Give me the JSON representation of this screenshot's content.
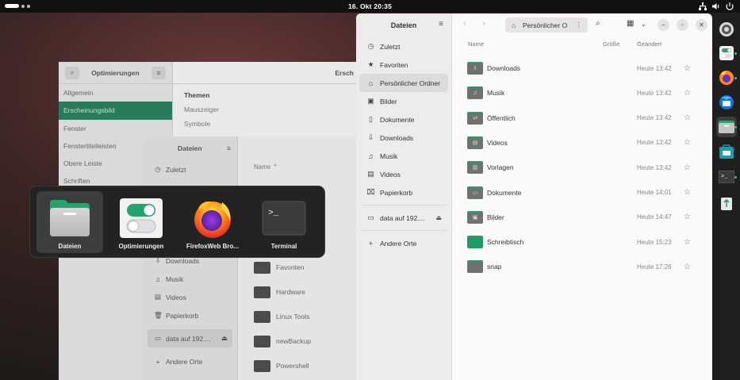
{
  "topbar": {
    "clock": "16. Okt  20:35"
  },
  "tweaks": {
    "title": "Optimierungen",
    "right_title": "Ersch",
    "items": [
      "Allgemein",
      "Erscheinungsbild",
      "Fenster",
      "Fenstertitelleisten",
      "Obere Leiste",
      "Schriften"
    ],
    "section": "Themen",
    "rows": [
      "Mauszeiger",
      "Symbole"
    ]
  },
  "files_bg": {
    "title": "Dateien",
    "sidebar": [
      "Zuletzt",
      "Downloads",
      "Musik",
      "Videos",
      "Papierkorb",
      "data auf 192....",
      "Andere Orte"
    ],
    "name_col": "Name",
    "folders": [
      "Favoriten",
      "Hardware",
      "Linux Tools",
      "newBackup",
      "Powershell"
    ]
  },
  "switcher": {
    "apps": [
      {
        "label": "Dateien",
        "icon": "files-icon"
      },
      {
        "label": "Optimierungen",
        "icon": "tweaks-icon"
      },
      {
        "label": "FirefoxWeb Bro...",
        "icon": "firefox-icon"
      },
      {
        "label": "Terminal",
        "icon": "terminal-icon"
      }
    ]
  },
  "files": {
    "title": "Dateien",
    "path": "Persönlicher O",
    "sidebar": {
      "places": [
        {
          "label": "Zuletzt",
          "icon": "clock-icon"
        },
        {
          "label": "Favoriten",
          "icon": "star-icon"
        },
        {
          "label": "Persönlicher Ordner",
          "icon": "home-icon"
        },
        {
          "label": "Bilder",
          "icon": "image-icon"
        },
        {
          "label": "Dokumente",
          "icon": "document-icon"
        },
        {
          "label": "Downloads",
          "icon": "download-icon"
        },
        {
          "label": "Musik",
          "icon": "music-icon"
        },
        {
          "label": "Videos",
          "icon": "video-icon"
        },
        {
          "label": "Papierkorb",
          "icon": "trash-icon"
        }
      ],
      "network": {
        "label": "data auf 192....",
        "icon": "network-drive-icon"
      },
      "other": {
        "label": "Andere Orte",
        "icon": "plus-icon"
      }
    },
    "columns": {
      "name": "Name",
      "size": "Größe",
      "modified": "Geändert"
    },
    "rows": [
      {
        "name": "Downloads",
        "modified": "Heute 13:42",
        "glyph": "⇩",
        "icon": "downloads-folder-icon"
      },
      {
        "name": "Musik",
        "modified": "Heute 13:42",
        "glyph": "♫",
        "icon": "music-folder-icon"
      },
      {
        "name": "Öffentlich",
        "modified": "Heute 13:42",
        "glyph": "⇄",
        "icon": "public-folder-icon"
      },
      {
        "name": "Videos",
        "modified": "Heute 13:42",
        "glyph": "▤",
        "icon": "videos-folder-icon"
      },
      {
        "name": "Vorlagen",
        "modified": "Heute 13:42",
        "glyph": "▥",
        "icon": "templates-folder-icon"
      },
      {
        "name": "Dokumente",
        "modified": "Heute 14:01",
        "glyph": "▭",
        "icon": "documents-folder-icon"
      },
      {
        "name": "Bilder",
        "modified": "Heute 14:47",
        "glyph": "▣",
        "icon": "pictures-folder-icon"
      },
      {
        "name": "Schreibtisch",
        "modified": "Heute 15:23",
        "glyph": "",
        "icon": "desktop-folder-icon",
        "green": true
      },
      {
        "name": "snap",
        "modified": "Heute 17:26",
        "glyph": "",
        "icon": "folder-icon"
      }
    ]
  },
  "dock": {
    "items": [
      "settings-icon",
      "tweaks-icon",
      "firefox-icon",
      "thunderbird-icon",
      "files-icon",
      "software-icon",
      "terminal-icon",
      "trash-icon"
    ]
  },
  "colors": {
    "accent": "#2a9b6a",
    "selection_bg": "#dcdcdc",
    "topbar": "#111111"
  }
}
